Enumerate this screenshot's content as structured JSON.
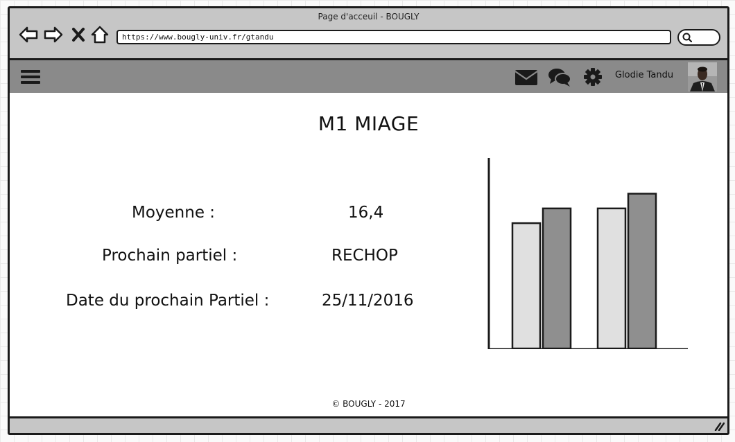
{
  "window": {
    "title": "Page d'acceuil - BOUGLY"
  },
  "browser": {
    "nav_icons": [
      "back-arrow-icon",
      "forward-arrow-icon",
      "close-icon",
      "home-icon"
    ],
    "url": "https://www.bougly-univ.fr/gtandu",
    "search_icon": "search-icon"
  },
  "header": {
    "menu_icon": "hamburger-menu-icon",
    "icons": [
      "envelope-icon",
      "chat-bubbles-icon",
      "gear-icon"
    ],
    "user_name": "Glodie Tandu",
    "avatar": "user-avatar"
  },
  "main": {
    "course_title": "M1 MIAGE",
    "rows": [
      {
        "label": "Moyenne :",
        "value": "16,4"
      },
      {
        "label": "Prochain partiel :",
        "value": "RECHOP"
      },
      {
        "label": "Date du prochain Partiel :",
        "value": "25/11/2016"
      }
    ]
  },
  "chart_data": {
    "type": "bar",
    "categories": [
      "",
      ""
    ],
    "series": [
      {
        "values": [
          68,
          76
        ],
        "color": "#e0e0e0"
      },
      {
        "values": [
          76,
          84
        ],
        "color": "#8f8f8f"
      }
    ],
    "ylim": [
      0,
      100
    ],
    "grid": false,
    "title": "",
    "xlabel": "",
    "ylabel": ""
  },
  "footer": {
    "copyright": "© BOUGLY - 2017"
  },
  "colors": {
    "browser_bar": "#c6c6c6",
    "app_header": "#8a8a8a",
    "border": "#1a1a1a"
  }
}
